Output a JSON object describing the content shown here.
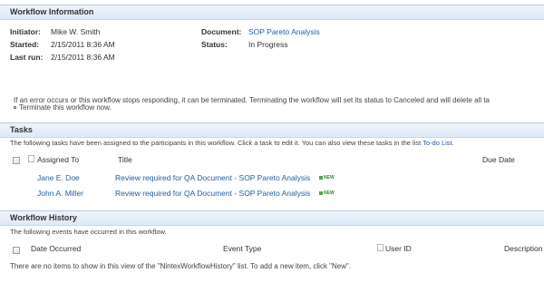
{
  "info": {
    "header": "Workflow Information",
    "initiator_label": "Initiator:",
    "initiator_value": "Mike W. Smith",
    "started_label": "Started:",
    "started_value": "2/15/2011 8:36 AM",
    "lastrun_label": "Last run:",
    "lastrun_value": "2/15/2011 8:36 AM",
    "document_label": "Document:",
    "document_value": "SOP Pareto Analysis",
    "status_label": "Status:",
    "status_value": "In Progress",
    "warning": "If an error occurs or this workflow stops responding, it can be terminated. Terminating the workflow will set its status to Canceled and will delete all ta",
    "terminate_link": "Terminate this workflow now."
  },
  "tasks": {
    "header": "Tasks",
    "description": "The following tasks have been assigned to the participants in this workflow. Click a task to edit it. You can also view these tasks in the list",
    "list_link": "To-do List",
    "list_link_suffix": ".",
    "columns": {
      "assigned_to": "Assigned To",
      "title": "Title",
      "due_date": "Due Date"
    },
    "rows": [
      {
        "assigned_to": "Jane E. Doe",
        "title": "Review required for QA Document - SOP Pareto Analysis",
        "badge": "NEW"
      },
      {
        "assigned_to": "John A. Miller",
        "title": "Review required for QA Document - SOP Pareto Analysis",
        "badge": "NEW"
      }
    ]
  },
  "history": {
    "header": "Workflow History",
    "description": "The following events have occurred in this workflow.",
    "columns": {
      "date_occurred": "Date Occurred",
      "event_type": "Event Type",
      "user_id": "User ID",
      "description": "Description"
    },
    "empty_message": "There are no items to show in this view of the \"NintexWorkflowHistory\" list. To add a new item, click \"New\"."
  },
  "colors": {
    "link": "#2060a8",
    "header_bg": "#dde9f6",
    "new_badge": "#2e8b2e"
  }
}
